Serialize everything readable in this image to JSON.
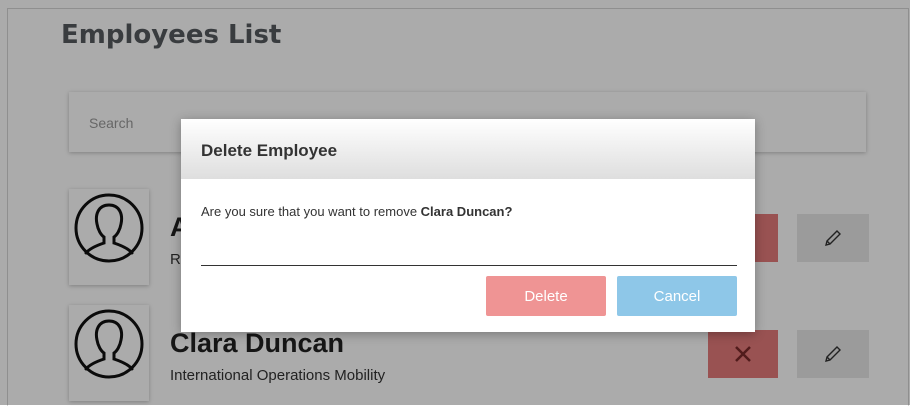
{
  "page": {
    "title": "Employees List"
  },
  "search": {
    "placeholder": "Search"
  },
  "employees": [
    {
      "name": "A",
      "department": "Re"
    },
    {
      "name": "Clara Duncan",
      "department": "International Operations Mobility"
    }
  ],
  "modal": {
    "title": "Delete Employee",
    "message": "Are you sure that you want to remove ",
    "target_name": "Clara Duncan?",
    "delete_label": "Delete",
    "cancel_label": "Cancel"
  },
  "colors": {
    "delete_red": "#e57b7b",
    "modal_delete": "#ef9494",
    "modal_cancel": "#8ec7e8",
    "edit_grey": "#e8e8e8"
  },
  "icons": [
    "avatar-icon",
    "close-icon",
    "pencil-icon"
  ]
}
